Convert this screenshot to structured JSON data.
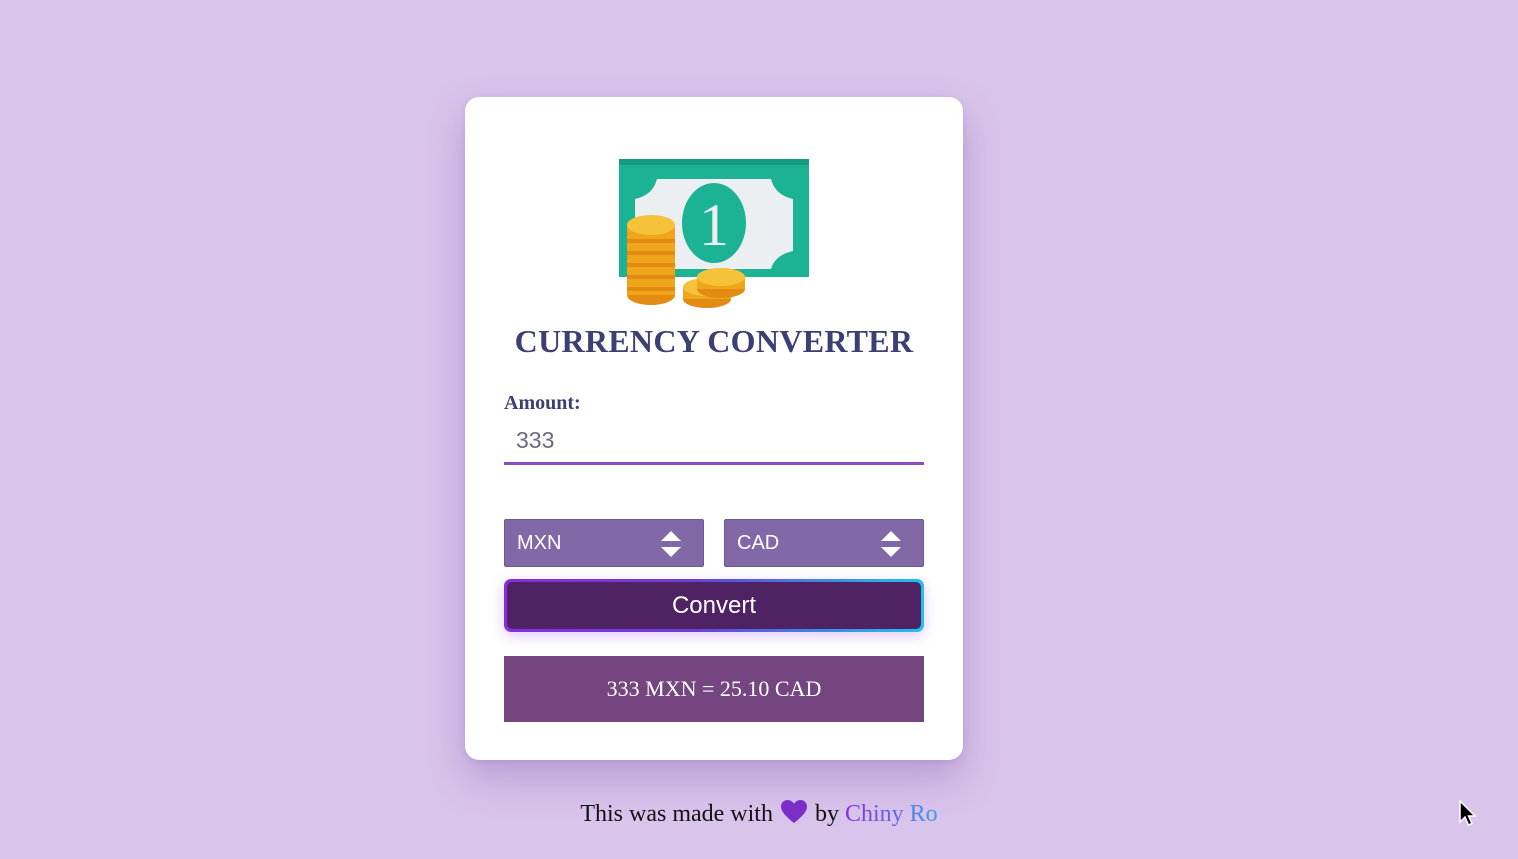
{
  "card": {
    "title": "CURRENCY CONVERTER",
    "money_icon": "money-bill-with-coins-icon",
    "amount_label": "Amount:",
    "amount_value": "333",
    "from_currency": "MXN",
    "to_currency": "CAD",
    "convert_label": "Convert",
    "result_text": "333 MXN = 25.10 CAD"
  },
  "footer": {
    "prefix": "This was made with",
    "heart_icon": "heart-icon",
    "by": "by",
    "author": "Chiny Ro"
  },
  "colors": {
    "background": "#d9c4ec",
    "title": "#3b3f73",
    "select": "#8169a8",
    "button": "#4f2363",
    "result": "#74457e",
    "heart": "#7b2fc8"
  }
}
